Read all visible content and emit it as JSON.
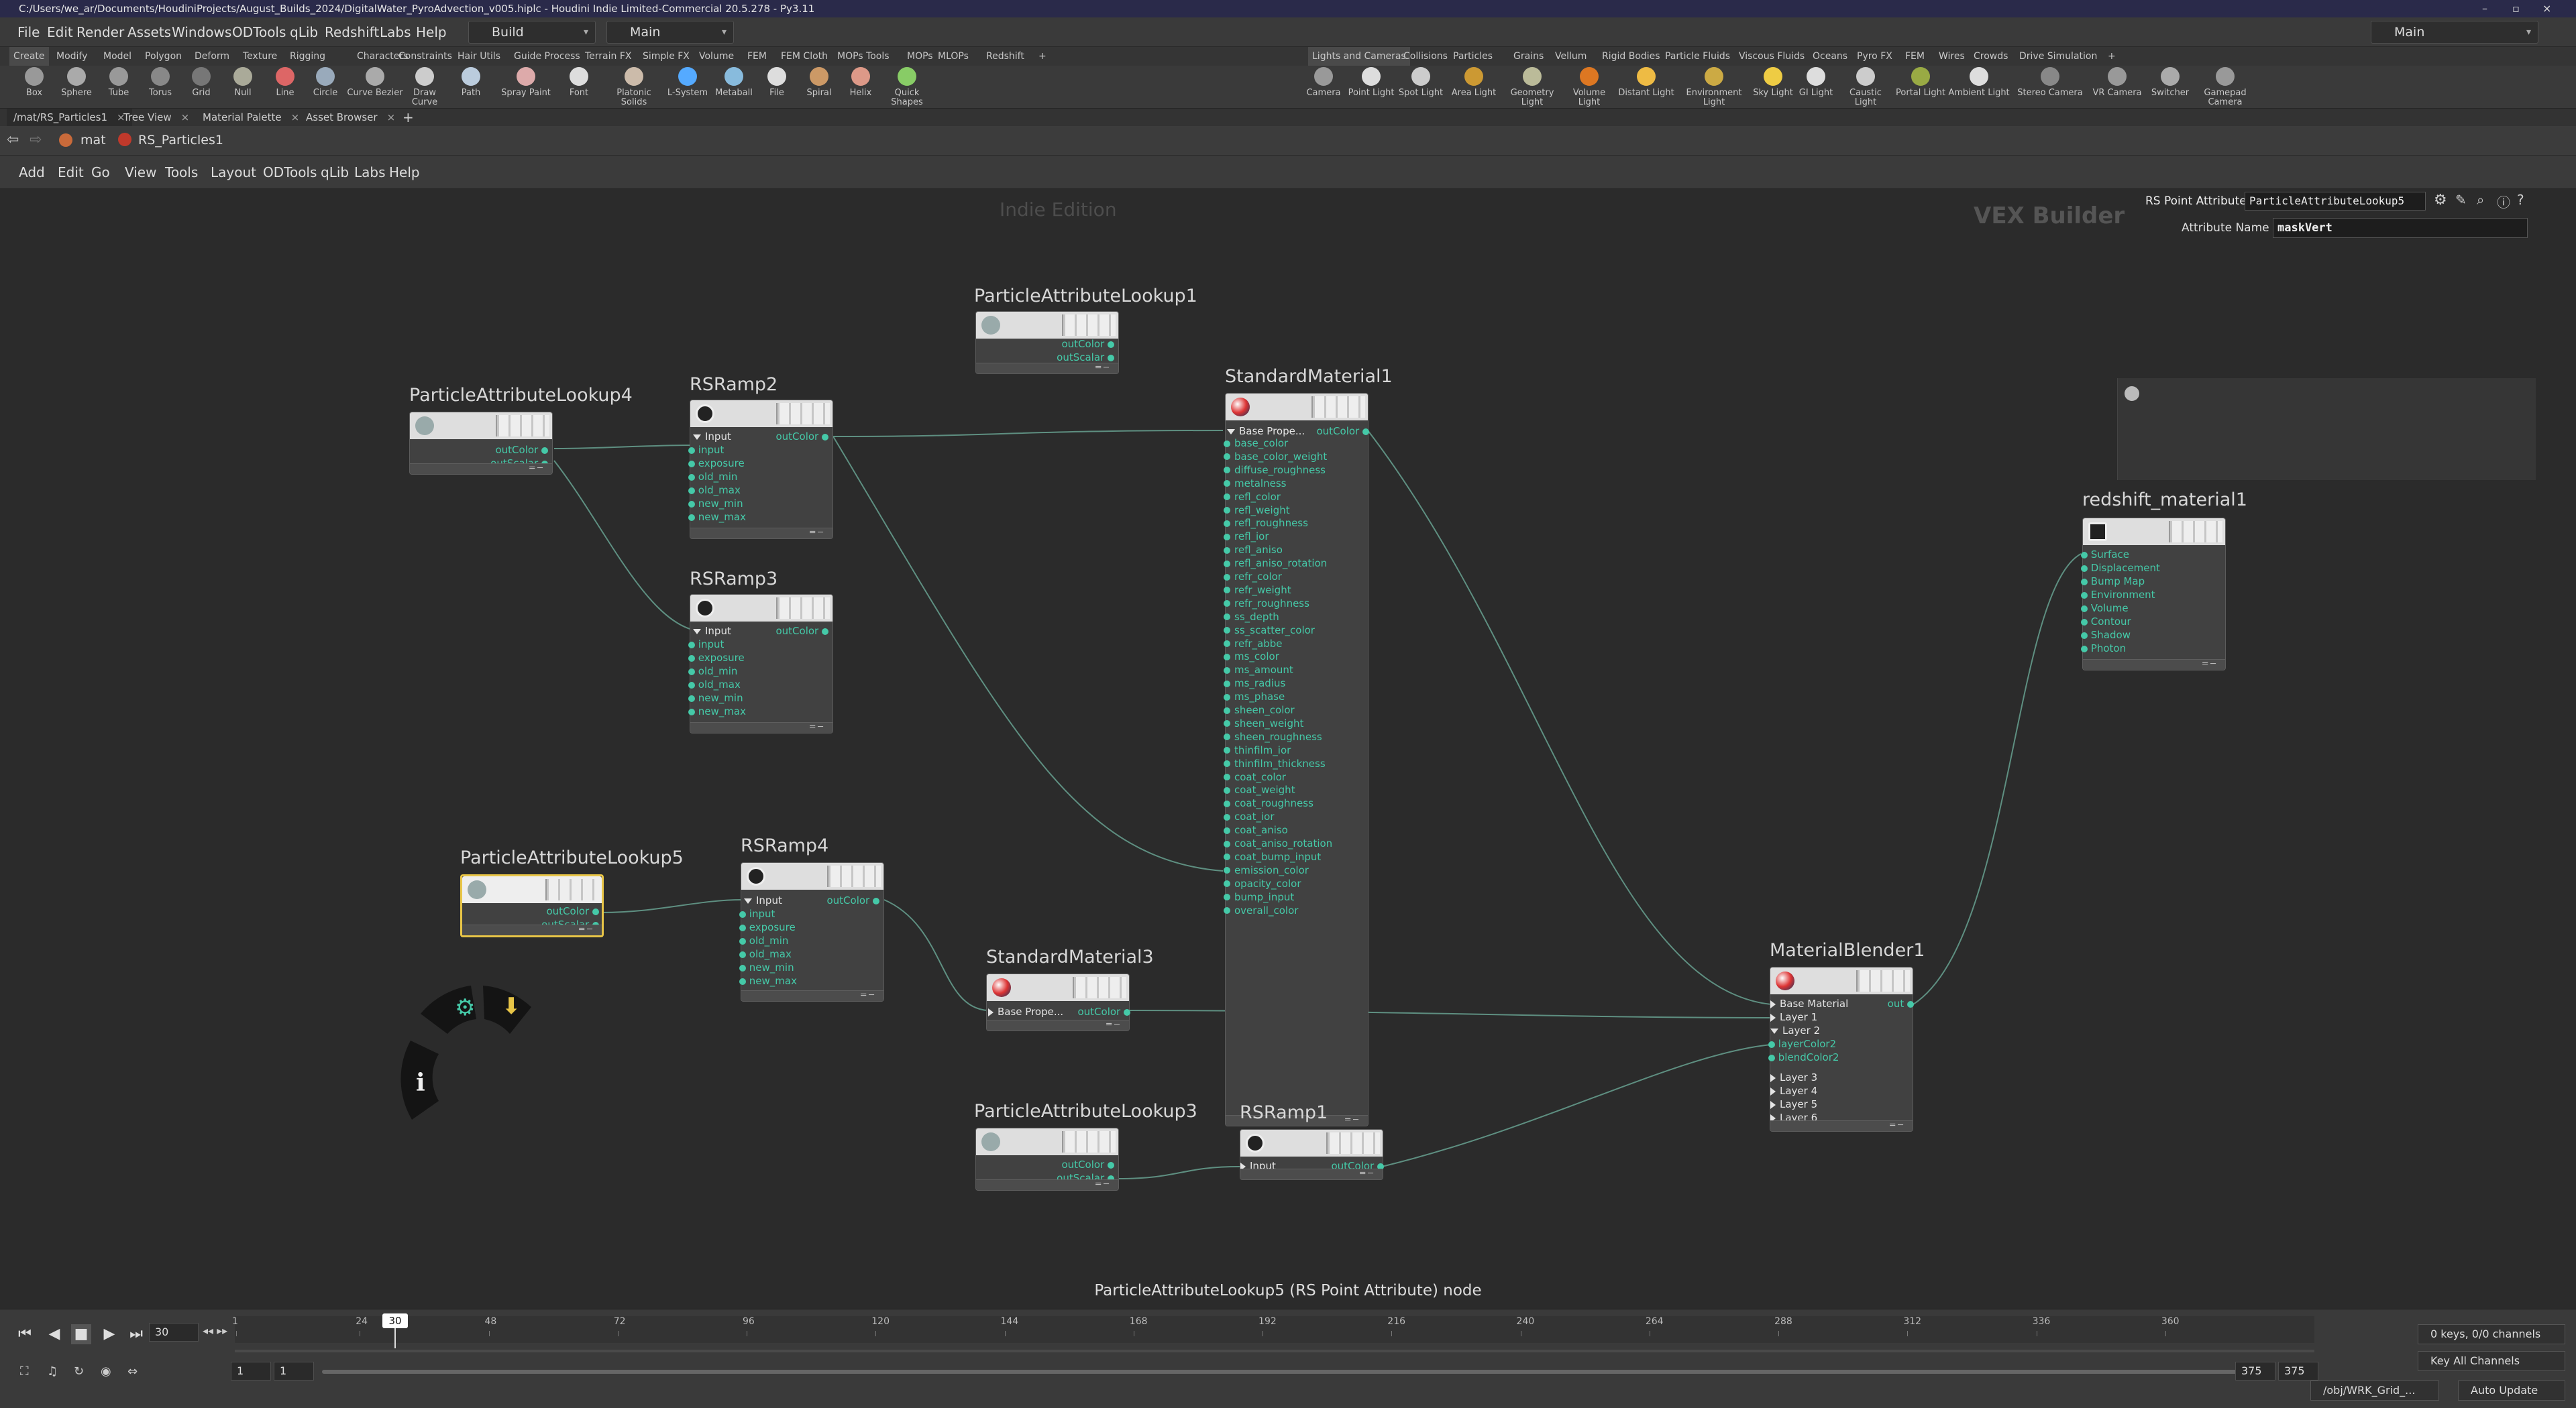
{
  "window": {
    "title": "C:/Users/we_ar/Documents/HoudiniProjects/August_Builds_2024/DigitalWater_PyroAdvection_v005.hiplc - Houdini Indie Limited-Commercial 20.5.278 - Py3.11"
  },
  "menubar": {
    "items": [
      "File",
      "Edit",
      "Render",
      "Assets",
      "Windows",
      "ODTools",
      "qLib",
      "Redshift",
      "Labs",
      "Help"
    ],
    "desktop_dropdown": "Build",
    "layout_dropdown": "Main",
    "right_dropdown": "Main"
  },
  "shelf_tabs_left": [
    "Create",
    "Modify",
    "Model",
    "Polygon",
    "Deform",
    "Texture",
    "Rigging",
    "Characters",
    "Constraints",
    "Hair Utils",
    "Guide Process",
    "Terrain FX",
    "Simple FX",
    "Volume",
    "FEM",
    "FEM Cloth",
    "MOPs Tools",
    "MOPs",
    "MLOPs",
    "Redshift"
  ],
  "shelf_tabs_right": [
    "Lights and Cameras",
    "Collisions",
    "Particles",
    "Grains",
    "Vellum",
    "Rigid Bodies",
    "Particle Fluids",
    "Viscous Fluids",
    "Oceans",
    "Pyro FX",
    "FEM",
    "Wires",
    "Crowds",
    "Drive Simulation"
  ],
  "tools_left": [
    "Box",
    "Sphere",
    "Tube",
    "Torus",
    "Grid",
    "Null",
    "Line",
    "Circle",
    "Curve Bezier",
    "Draw Curve",
    "Path",
    "Spray Paint",
    "Font",
    "Platonic Solids",
    "L-System",
    "Metaball",
    "File",
    "Spiral",
    "Helix",
    "Quick Shapes"
  ],
  "tools_right": [
    "Camera",
    "Point Light",
    "Spot Light",
    "Area Light",
    "Geometry Light",
    "Volume Light",
    "Distant Light",
    "Environment Light",
    "Sky Light",
    "GI Light",
    "Caustic Light",
    "Portal Light",
    "Ambient Light",
    "Stereo Camera",
    "VR Camera",
    "Switcher",
    "Gamepad Camera"
  ],
  "pane_tabs": [
    "/mat/RS_Particles1",
    "Tree View",
    "Material Palette",
    "Asset Browser"
  ],
  "path": {
    "context": "mat",
    "node": "RS_Particles1"
  },
  "network_menu": [
    "Add",
    "Edit",
    "Go",
    "View",
    "Tools",
    "Layout",
    "ODTools",
    "qLib",
    "Labs",
    "Help"
  ],
  "watermarks": {
    "edition": "Indie Edition",
    "builder": "VEX Builder"
  },
  "parm": {
    "type": "RS Point Attribute",
    "node": "ParticleAttributeLookup5",
    "label": "Attribute Name",
    "value": "maskVert"
  },
  "nodes": {
    "pal1": {
      "name": "ParticleAttributeLookup1",
      "outs": [
        "outColor",
        "outScalar"
      ]
    },
    "pal4": {
      "name": "ParticleAttributeLookup4",
      "outs": [
        "outColor",
        "outScalar"
      ]
    },
    "pal5": {
      "name": "ParticleAttributeLookup5",
      "outs": [
        "outColor",
        "outScalar"
      ]
    },
    "pal3": {
      "name": "ParticleAttributeLookup3",
      "outs": [
        "outColor",
        "outScalar"
      ]
    },
    "ramp2": {
      "name": "RSRamp2",
      "group": "Input",
      "out": "outColor",
      "ins": [
        "input",
        "exposure",
        "old_min",
        "old_max",
        "new_min",
        "new_max"
      ]
    },
    "ramp3": {
      "name": "RSRamp3",
      "group": "Input",
      "out": "outColor",
      "ins": [
        "input",
        "exposure",
        "old_min",
        "old_max",
        "new_min",
        "new_max"
      ]
    },
    "ramp4": {
      "name": "RSRamp4",
      "group": "Input",
      "out": "outColor",
      "ins": [
        "input",
        "exposure",
        "old_min",
        "old_max",
        "new_min",
        "new_max"
      ]
    },
    "ramp1": {
      "name": "RSRamp1",
      "group": "Input",
      "out": "outColor"
    },
    "sm1": {
      "name": "StandardMaterial1",
      "group": "Base Prope...",
      "out": "outColor",
      "ins": [
        "base_color",
        "base_color_weight",
        "diffuse_roughness",
        "metalness",
        "refl_color",
        "refl_weight",
        "refl_roughness",
        "refl_ior",
        "refl_aniso",
        "refl_aniso_rotation",
        "refr_color",
        "refr_weight",
        "refr_roughness",
        "ss_depth",
        "ss_scatter_color",
        "refr_abbe",
        "ms_color",
        "ms_amount",
        "ms_radius",
        "ms_phase",
        "sheen_color",
        "sheen_weight",
        "sheen_roughness",
        "thinfilm_ior",
        "thinfilm_thickness",
        "coat_color",
        "coat_weight",
        "coat_roughness",
        "coat_ior",
        "coat_aniso",
        "coat_aniso_rotation",
        "coat_bump_input",
        "emission_color",
        "opacity_color",
        "bump_input",
        "overall_color"
      ]
    },
    "sm3": {
      "name": "StandardMaterial3",
      "group": "Base Prope...",
      "out": "outColor"
    },
    "mb1": {
      "name": "MaterialBlender1",
      "out": "out",
      "rows": [
        "Base Material",
        "Layer 1",
        "Layer 2",
        "layerColor2",
        "blendColor2",
        "Layer 3",
        "Layer 4",
        "Layer 5",
        "Layer 6"
      ]
    },
    "rsm": {
      "name": "redshift_material1",
      "ins": [
        "Surface",
        "Displacement",
        "Bump Map",
        "Environment",
        "Volume",
        "Contour",
        "Shadow",
        "Photon"
      ]
    }
  },
  "status_text": "ParticleAttributeLookup5 (RS Point Attribute) node",
  "timeline": {
    "current_frame": "30",
    "frame_marker": "30",
    "ticks": [
      "1",
      "24",
      "48",
      "72",
      "96",
      "120",
      "144",
      "168",
      "192",
      "216",
      "240",
      "264",
      "288",
      "312",
      "336",
      "360"
    ],
    "range_start": "1",
    "range_start2": "1",
    "range_end": "375",
    "range_end2": "375",
    "keys": "0 keys, 0/0 channels",
    "key_all": "Key All Channels",
    "context_path": "/obj/WRK_Grid_...",
    "auto_update": "Auto Update"
  },
  "colors": {
    "accent": "#45c9a8",
    "selected": "#e8c547",
    "canvas": "#2b2b2b"
  }
}
